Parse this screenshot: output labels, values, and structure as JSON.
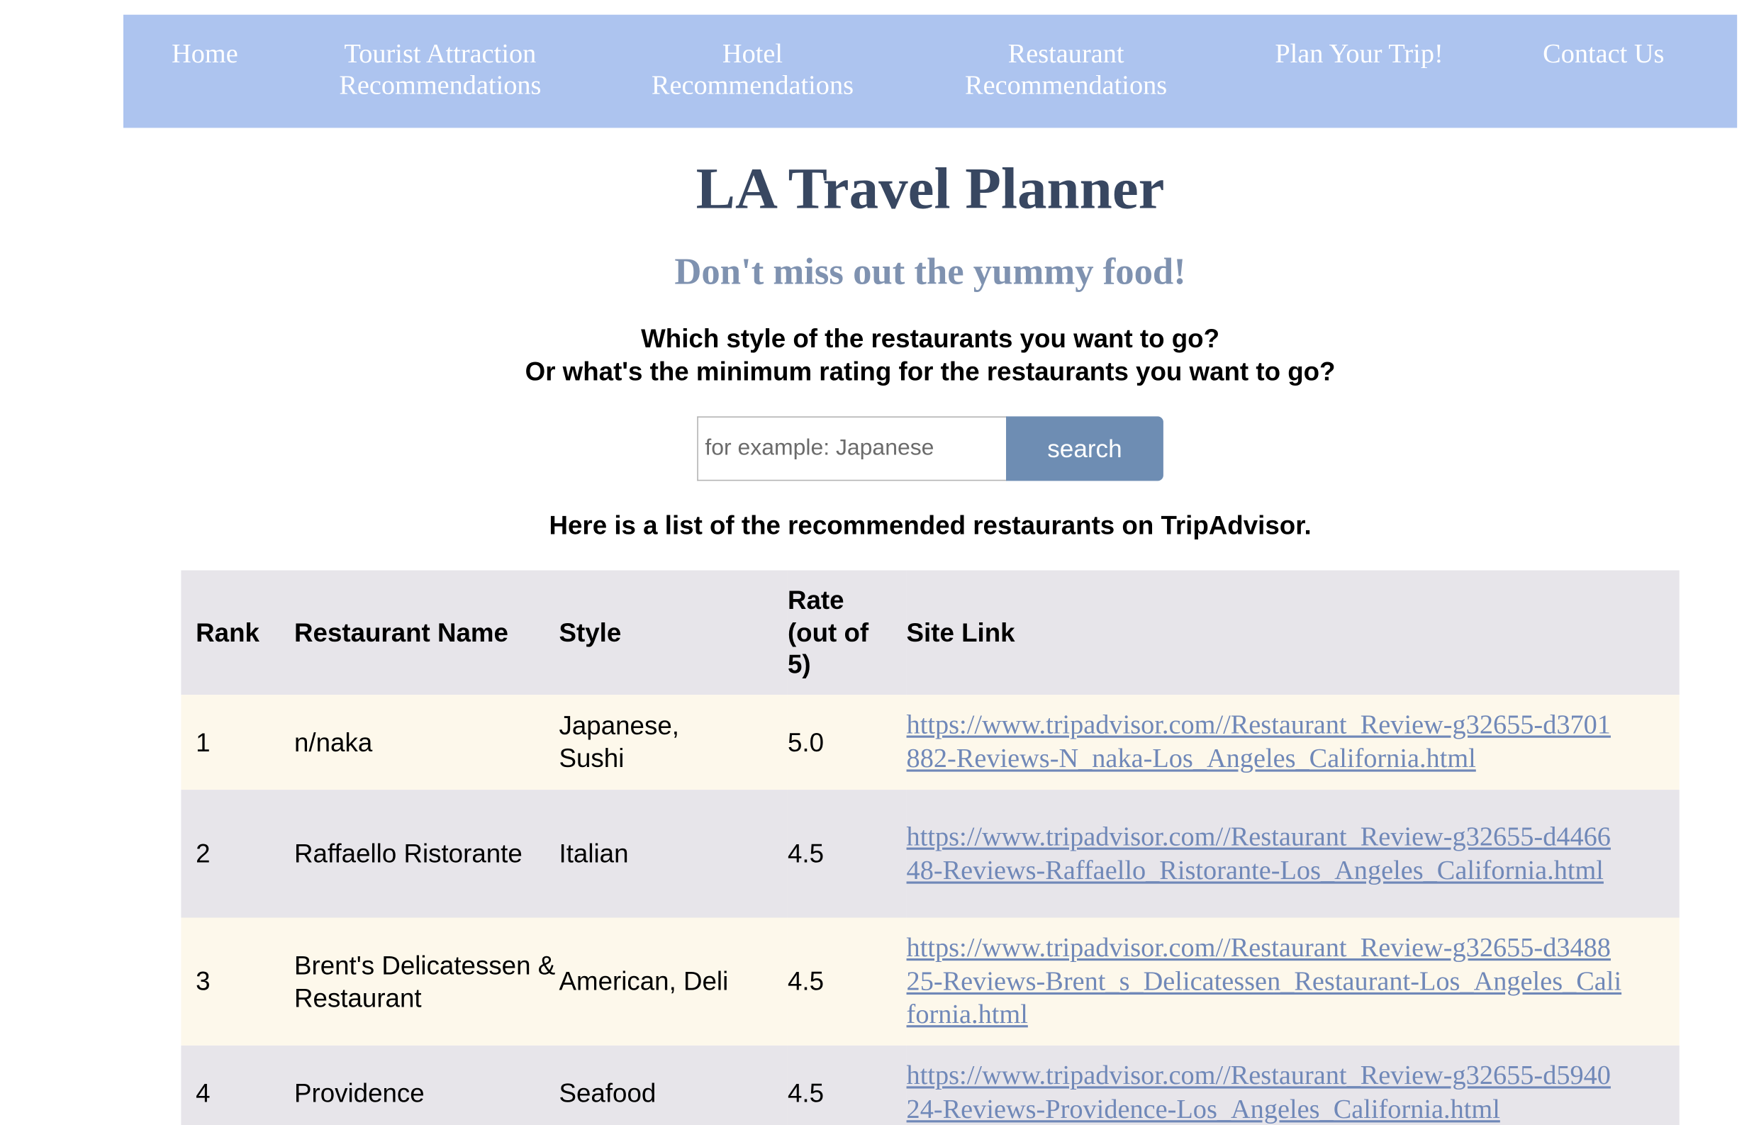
{
  "nav": {
    "items": [
      {
        "line1": "Home",
        "line2": ""
      },
      {
        "line1": "Tourist Attraction",
        "line2": "Recommendations"
      },
      {
        "line1": "Hotel",
        "line2": "Recommendations"
      },
      {
        "line1": "Restaurant",
        "line2": "Recommendations"
      },
      {
        "line1": "Plan Your Trip!",
        "line2": ""
      },
      {
        "line1": "Contact Us",
        "line2": ""
      }
    ]
  },
  "header": {
    "title": "LA Travel Planner",
    "subtitle": "Don't miss out the yummy food!"
  },
  "search": {
    "question_line1": "Which style of the restaurants you want to go?",
    "question_line2": "Or what's the minimum rating for the restaurants you want to go?",
    "placeholder": "for example: Japanese",
    "button_label": "search"
  },
  "results": {
    "caption": "Here is a list of the recommended restaurants on TripAdvisor.",
    "columns": [
      "Rank",
      "Restaurant Name",
      "Style",
      "Rate (out of 5)",
      "Site Link"
    ],
    "rows": [
      {
        "rank": "1",
        "name": "n/naka",
        "style": "Japanese, Sushi",
        "rate": "5.0",
        "link": "https://www.tripadvisor.com//Restaurant_Review-g32655-d3701882-Reviews-N_naka-Los_Angeles_California.html"
      },
      {
        "rank": "2",
        "name": "Raffaello Ristorante",
        "style": "Italian",
        "rate": "4.5",
        "link": "https://www.tripadvisor.com//Restaurant_Review-g32655-d446648-Reviews-Raffaello_Ristorante-Los_Angeles_California.html"
      },
      {
        "rank": "3",
        "name": "Brent's Delicatessen & Restaurant",
        "style": "American, Deli",
        "rate": "4.5",
        "link": "https://www.tripadvisor.com//Restaurant_Review-g32655-d348825-Reviews-Brent_s_Delicatessen_Restaurant-Los_Angeles_California.html"
      },
      {
        "rank": "4",
        "name": "Providence",
        "style": "Seafood",
        "rate": "4.5",
        "link": "https://www.tripadvisor.com//Restaurant_Review-g32655-d594024-Reviews-Providence-Los_Angeles_California.html"
      }
    ]
  }
}
